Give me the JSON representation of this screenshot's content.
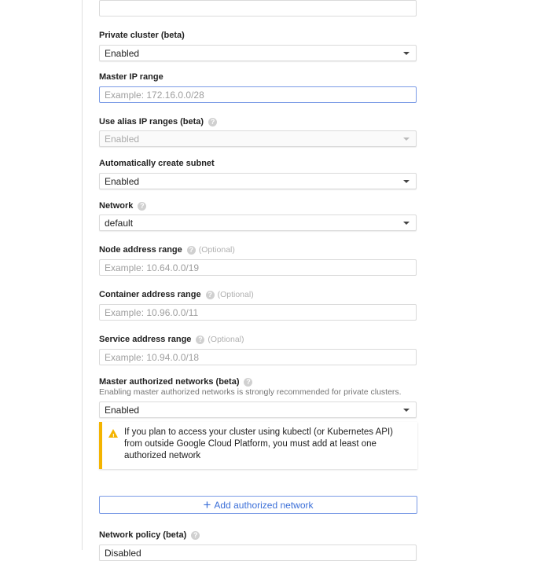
{
  "top_input": {
    "value": ""
  },
  "private_cluster": {
    "label": "Private cluster (beta)",
    "value": "Enabled"
  },
  "master_ip_range": {
    "label": "Master IP range",
    "placeholder": "Example: 172.16.0.0/28"
  },
  "alias_ip": {
    "label": "Use alias IP ranges (beta)",
    "value": "Enabled",
    "disabled": true
  },
  "auto_subnet": {
    "label": "Automatically create subnet",
    "value": "Enabled"
  },
  "network": {
    "label": "Network",
    "value": "default"
  },
  "node_range": {
    "label": "Node address range",
    "optional": "(Optional)",
    "placeholder": "Example: 10.64.0.0/19"
  },
  "container_range": {
    "label": "Container address range",
    "optional": "(Optional)",
    "placeholder": "Example: 10.96.0.0/11"
  },
  "service_range": {
    "label": "Service address range",
    "optional": "(Optional)",
    "placeholder": "Example: 10.94.0.0/18"
  },
  "man": {
    "label": "Master authorized networks (beta)",
    "helper": "Enabling master authorized networks is strongly recommended for private clusters.",
    "value": "Enabled"
  },
  "warning": {
    "icon": "warning-icon",
    "text": "If you plan to access your cluster using kubectl (or Kubernetes API) from outside Google Cloud Platform, you must add at least one authorized network",
    "color": "#f4b400"
  },
  "add_network": {
    "label": "Add authorized network"
  },
  "network_policy": {
    "label": "Network policy (beta)",
    "value": "Disabled"
  },
  "colors": {
    "accent": "#3b6fd8"
  }
}
